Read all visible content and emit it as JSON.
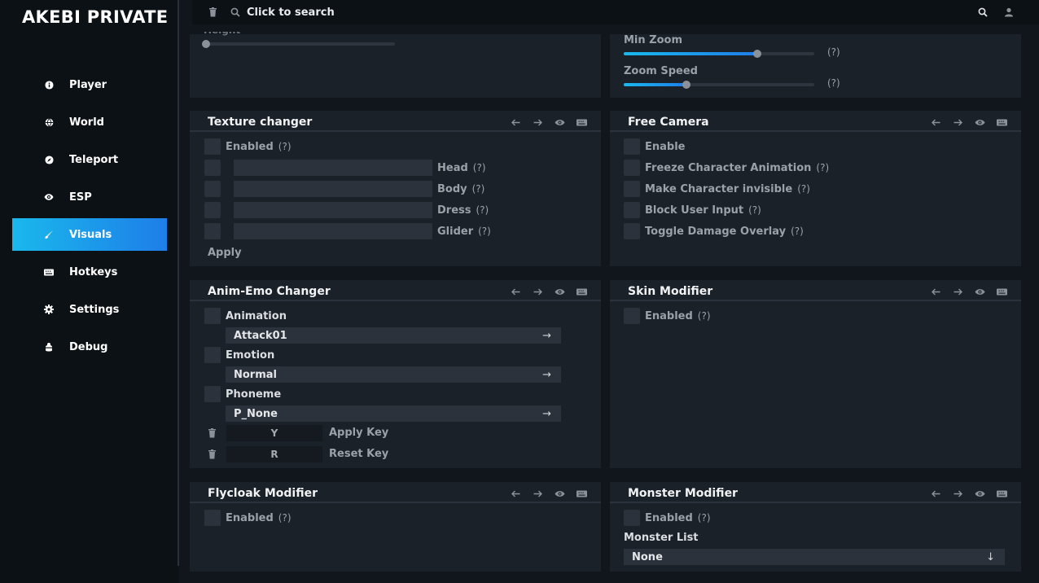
{
  "app": {
    "title": "AKEBI PRIVATE"
  },
  "sidebar": {
    "items": [
      {
        "label": "Player",
        "icon": "info-icon"
      },
      {
        "label": "World",
        "icon": "globe-icon"
      },
      {
        "label": "Teleport",
        "icon": "compass-icon"
      },
      {
        "label": "ESP",
        "icon": "eye-icon"
      },
      {
        "label": "Visuals",
        "icon": "brush-icon",
        "active": true
      },
      {
        "label": "Hotkeys",
        "icon": "keyboard-icon"
      },
      {
        "label": "Settings",
        "icon": "gear-icon"
      },
      {
        "label": "Debug",
        "icon": "bug-icon"
      }
    ]
  },
  "topbar": {
    "search_placeholder": "Click to search"
  },
  "colors": {
    "accent_start": "#1ab8ec",
    "accent_end": "#1e7ee8",
    "panel_bg": "#1b2129",
    "app_bg": "#11161c"
  },
  "top_left_panel": {
    "height_label": "Height",
    "height_value": 0.01
  },
  "top_right_panel": {
    "min_zoom_label": "Min Zoom",
    "min_zoom_value": 0.7,
    "zoom_speed_label": "Zoom Speed",
    "zoom_speed_value": 0.33,
    "help": "(?)"
  },
  "texture_changer": {
    "title": "Texture changer",
    "enabled_label": "Enabled",
    "help": "(?)",
    "rows": [
      {
        "label": "Head"
      },
      {
        "label": "Body"
      },
      {
        "label": "Dress"
      },
      {
        "label": "Glider"
      }
    ],
    "apply_label": "Apply"
  },
  "free_camera": {
    "title": "Free Camera",
    "help": "(?)",
    "options": [
      {
        "label": "Enable",
        "help": false
      },
      {
        "label": "Freeze Character Animation",
        "help": true
      },
      {
        "label": "Make Character invisible",
        "help": true
      },
      {
        "label": "Block User Input",
        "help": true
      },
      {
        "label": "Toggle Damage Overlay",
        "help": true
      }
    ]
  },
  "anim_emo": {
    "title": "Anim-Emo Changer",
    "groups": [
      {
        "label": "Animation",
        "value": "Attack01"
      },
      {
        "label": "Emotion",
        "value": "Normal"
      },
      {
        "label": "Phoneme",
        "value": "P_None"
      }
    ],
    "keys": [
      {
        "key": "Y",
        "label": "Apply Key"
      },
      {
        "key": "R",
        "label": "Reset Key"
      }
    ]
  },
  "skin_modifier": {
    "title": "Skin Modifier",
    "enabled_label": "Enabled",
    "help": "(?)"
  },
  "flycloak": {
    "title": "Flycloak Modifier",
    "enabled_label": "Enabled",
    "help": "(?)"
  },
  "monster_modifier": {
    "title": "Monster Modifier",
    "enabled_label": "Enabled",
    "help": "(?)",
    "list_label": "Monster List",
    "list_value": "None"
  }
}
